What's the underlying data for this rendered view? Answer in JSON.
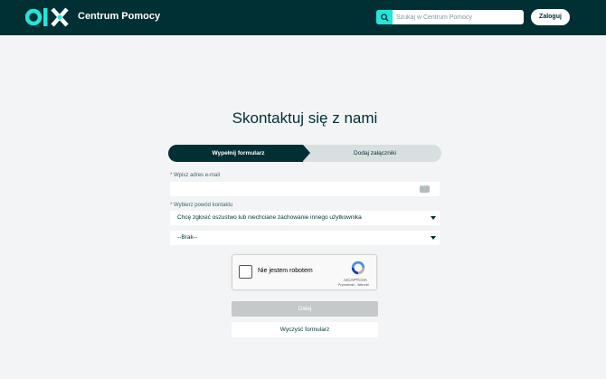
{
  "header": {
    "logo_text": "olx",
    "brand": "Centrum Pomocy",
    "search_placeholder": "Szukaj w Centrum Pomocy",
    "login_label": "Zaloguj"
  },
  "page": {
    "title": "Skontaktuj się z nami"
  },
  "steps": {
    "items": [
      {
        "label": "Wypełnij formularz",
        "active": true
      },
      {
        "label": "Dodaj załączniki",
        "active": false
      }
    ]
  },
  "form": {
    "email": {
      "required_marker": "*",
      "label": "Wpisz adres e-mail",
      "value": ""
    },
    "reason": {
      "required_marker": "*",
      "label": "Wybierz powód kontaktu",
      "selected": "Chcę zgłosić oszustwo lub niechciane zachowanie innego użytkownika"
    },
    "subreason": {
      "selected": "--Brak--"
    },
    "captcha": {
      "label": "Nie jestem robotem",
      "brand": "reCAPTCHA",
      "links": "Prywatność - Warunki"
    },
    "submit_label": "Dalej",
    "clear_label": "Wyczyść formularz"
  },
  "colors": {
    "header_bg": "#002f34",
    "accent_teal": "#23e5db",
    "page_bg": "#f2f4f5",
    "disabled_button": "#c5c9ca"
  }
}
